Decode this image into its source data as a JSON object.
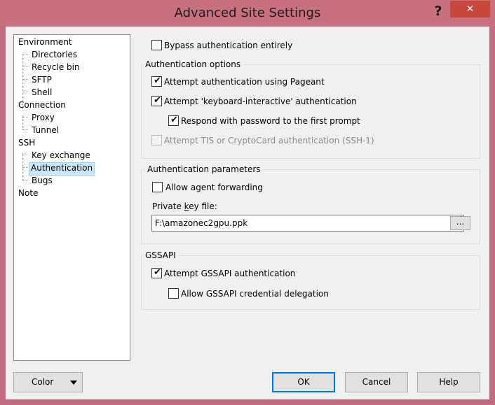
{
  "window": {
    "title": "Advanced Site Settings",
    "help_glyph": "?",
    "close_glyph": "✕"
  },
  "tree": {
    "items": [
      {
        "label": "Environment"
      },
      {
        "label": "Directories"
      },
      {
        "label": "Recycle bin"
      },
      {
        "label": "SFTP"
      },
      {
        "label": "Shell"
      },
      {
        "label": "Connection"
      },
      {
        "label": "Proxy"
      },
      {
        "label": "Tunnel"
      },
      {
        "label": "SSH"
      },
      {
        "label": "Key exchange"
      },
      {
        "label": "Authentication",
        "selected": true
      },
      {
        "label": "Bugs"
      },
      {
        "label": "Note"
      }
    ]
  },
  "auth": {
    "bypass": {
      "label": "Bypass authentication entirely",
      "checked": false
    },
    "options_group": {
      "title": "Authentication options",
      "pageant": {
        "label": "Attempt authentication using Pageant",
        "checked": true
      },
      "keyboard_interactive": {
        "label": "Attempt 'keyboard-interactive' authentication",
        "checked": true
      },
      "respond_password": {
        "label": "Respond with password to the first prompt",
        "checked": true
      },
      "tis": {
        "label": "Attempt TIS or CryptoCard authentication (SSH-1)",
        "checked": false,
        "disabled": true
      }
    },
    "params_group": {
      "title": "Authentication parameters",
      "agent_forwarding": {
        "label": "Allow agent forwarding",
        "checked": false
      },
      "private_key_label_pre": "Private ",
      "private_key_label_u": "k",
      "private_key_label_post": "ey file:",
      "private_key_value": "F:\\amazonec2gpu.ppk",
      "browse_label": "..."
    },
    "gssapi_group": {
      "title": "GSSAPI",
      "attempt": {
        "label": "Attempt GSSAPI authentication",
        "checked": true
      },
      "delegation": {
        "label": "Allow GSSAPI credential delegation",
        "checked": false
      }
    }
  },
  "footer": {
    "color_label": "Color",
    "ok_label": "OK",
    "cancel_label": "Cancel",
    "help_label": "Help"
  },
  "check_glyph": "✔"
}
